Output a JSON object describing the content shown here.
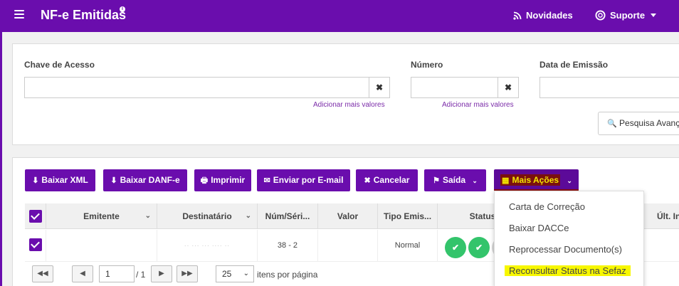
{
  "topbar": {
    "title": "NF-e Emitidas",
    "info_mark": "i",
    "novidades": "Novidades",
    "suporte": "Suporte"
  },
  "filters": {
    "chave_label": "Chave de Acesso",
    "numero_label": "Número",
    "data_label": "Data de Emissão",
    "clear_symbol": "✖",
    "add_more": "Adicionar mais valores",
    "advanced_search": "Pesquisa Avançada"
  },
  "actions": {
    "baixar_xml": "Baixar XML",
    "baixar_danfe": "Baixar DANF-e",
    "imprimir": "Imprimir",
    "enviar_email": "Enviar por E-mail",
    "cancelar": "Cancelar",
    "saida": "Saída",
    "mais_acoes": "Mais Ações"
  },
  "table": {
    "columns": [
      "Emitente",
      "Destinatário",
      "Núm/Séri...",
      "Valor",
      "Tipo Emis...",
      "Status",
      "Últ. Inte"
    ],
    "rows": [
      {
        "emitente": "",
        "destinatario": "·· ··· ··· ···· ··",
        "num_serie": "38 - 2",
        "valor": "",
        "tipo": "Normal"
      }
    ]
  },
  "pager": {
    "page": "1",
    "of": "/ 1",
    "page_size": "25",
    "per_page_label": "itens por página"
  },
  "dropdown": {
    "items": [
      "Carta de Correção",
      "Baixar DACCe",
      "Reprocessar Documento(s)",
      "Reconsultar Status na Sefaz"
    ]
  },
  "colors": {
    "brand": "#6a0dad",
    "status_ok": "#33c46b",
    "highlight": "#f7f700"
  }
}
